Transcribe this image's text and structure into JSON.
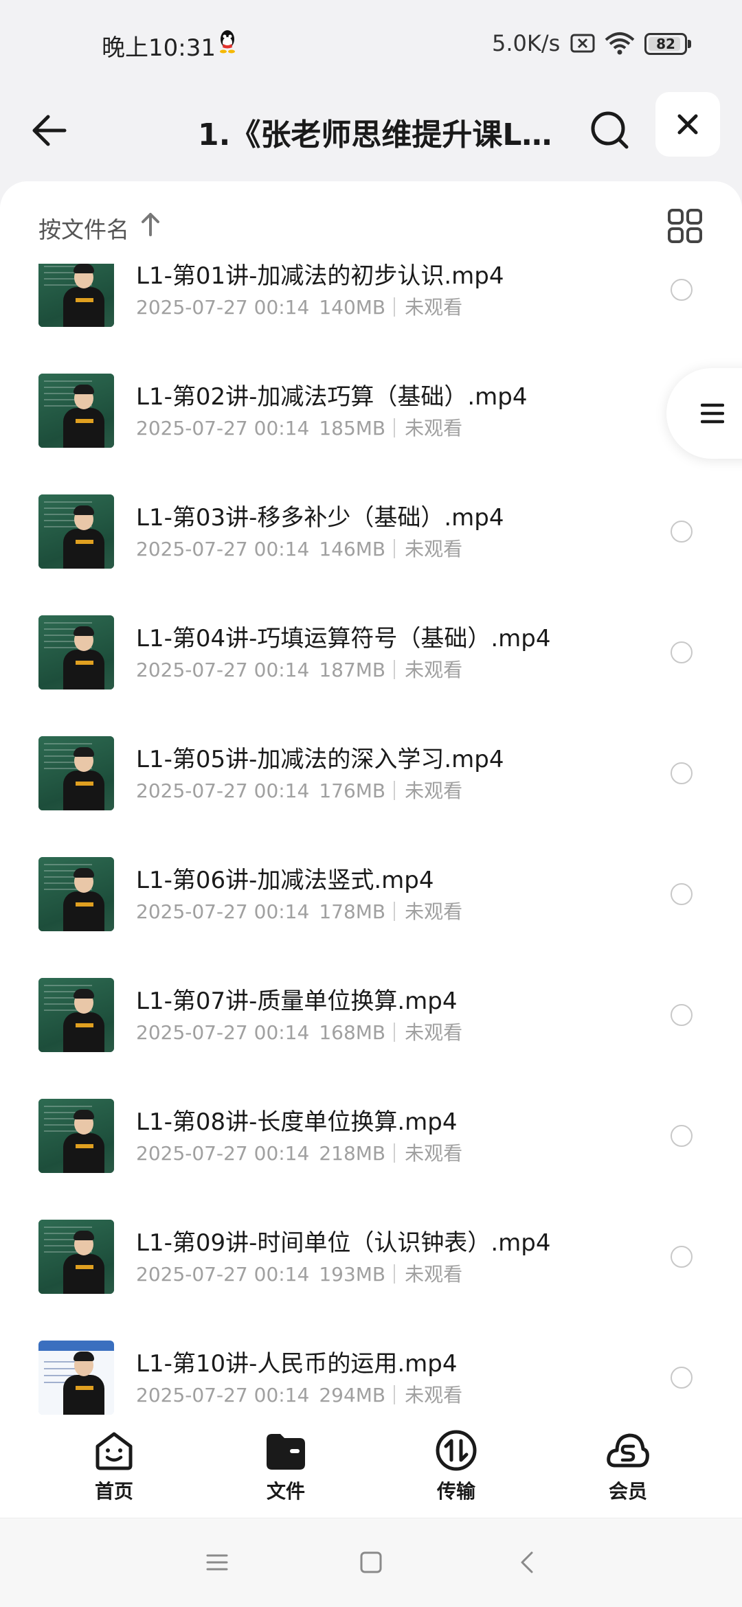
{
  "status_bar": {
    "time": "晚上10:31",
    "net_speed": "5.0K/s",
    "battery": "82",
    "battery_level": 0.82
  },
  "header": {
    "title": "1.《张老师思维提升课L..."
  },
  "sort": {
    "label": "按文件名"
  },
  "files": [
    {
      "name": "L1-第01讲-加减法的初步认识.mp4",
      "date": "2025-07-27 00:14",
      "size": "140MB",
      "status": "未观看"
    },
    {
      "name": "L1-第02讲-加减法巧算（基础）.mp4",
      "date": "2025-07-27 00:14",
      "size": "185MB",
      "status": "未观看"
    },
    {
      "name": "L1-第03讲-移多补少（基础）.mp4",
      "date": "2025-07-27 00:14",
      "size": "146MB",
      "status": "未观看"
    },
    {
      "name": "L1-第04讲-巧填运算符号（基础）.mp4",
      "date": "2025-07-27 00:14",
      "size": "187MB",
      "status": "未观看"
    },
    {
      "name": "L1-第05讲-加减法的深入学习.mp4",
      "date": "2025-07-27 00:14",
      "size": "176MB",
      "status": "未观看"
    },
    {
      "name": "L1-第06讲-加减法竖式.mp4",
      "date": "2025-07-27 00:14",
      "size": "178MB",
      "status": "未观看"
    },
    {
      "name": "L1-第07讲-质量单位换算.mp4",
      "date": "2025-07-27 00:14",
      "size": "168MB",
      "status": "未观看"
    },
    {
      "name": "L1-第08讲-长度单位换算.mp4",
      "date": "2025-07-27 00:14",
      "size": "218MB",
      "status": "未观看"
    },
    {
      "name": "L1-第09讲-时间单位（认识钟表）.mp4",
      "date": "2025-07-27 00:14",
      "size": "193MB",
      "status": "未观看"
    },
    {
      "name": "L1-第10讲-人民币的运用.mp4",
      "date": "2025-07-27 00:14",
      "size": "294MB",
      "status": "未观看"
    }
  ],
  "tabs": [
    {
      "label": "首页",
      "icon": "smile-home-icon"
    },
    {
      "label": "文件",
      "icon": "folder-icon"
    },
    {
      "label": "传输",
      "icon": "transfer-icon"
    },
    {
      "label": "会员",
      "icon": "cloud-vip-icon"
    }
  ],
  "colors": {
    "background": "#f2f2f4",
    "text_primary": "#1a1a1a",
    "text_secondary": "#a0a0a0"
  }
}
